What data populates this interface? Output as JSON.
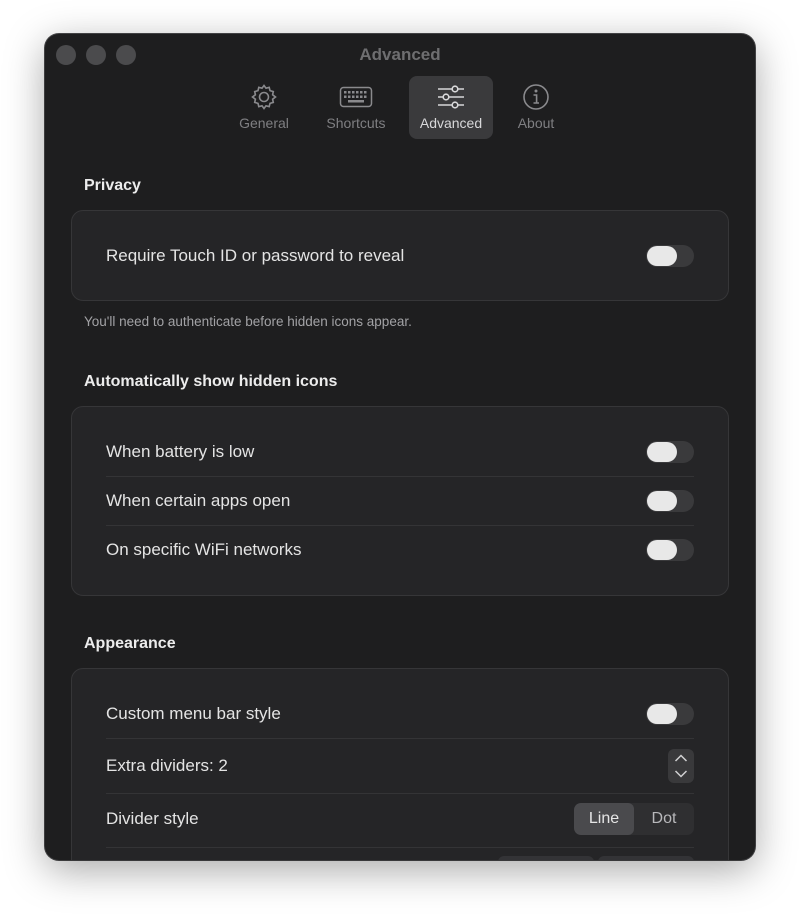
{
  "window": {
    "title": "Advanced"
  },
  "tabs": [
    {
      "label": "General",
      "icon": "gear-icon"
    },
    {
      "label": "Shortcuts",
      "icon": "keyboard-icon"
    },
    {
      "label": "Advanced",
      "icon": "sliders-icon",
      "active": true
    },
    {
      "label": "About",
      "icon": "info-icon"
    }
  ],
  "privacy": {
    "title": "Privacy",
    "rows": [
      {
        "label": "Require Touch ID or password to reveal",
        "on": false
      }
    ],
    "caption": "You'll need to authenticate before hidden icons appear."
  },
  "auto_show": {
    "title": "Automatically show hidden icons",
    "rows": [
      {
        "label": "When battery is low",
        "on": false
      },
      {
        "label": "When certain apps open",
        "on": false
      },
      {
        "label": "On specific WiFi networks",
        "on": false
      }
    ]
  },
  "appearance": {
    "title": "Appearance",
    "custom_style": {
      "label": "Custom menu bar style",
      "on": false
    },
    "extra_dividers": {
      "label": "Extra dividers: 2",
      "value": 2
    },
    "divider_style": {
      "label": "Divider style",
      "options": [
        "Line",
        "Dot"
      ],
      "selected": "Line"
    }
  },
  "colors": {
    "window_bg": "#1e1e1f",
    "group_bg": "#252527",
    "toggle_track": "#3a3a3c",
    "toggle_knob": "#e8e8e8",
    "active_tab": "#3a3a3c"
  }
}
